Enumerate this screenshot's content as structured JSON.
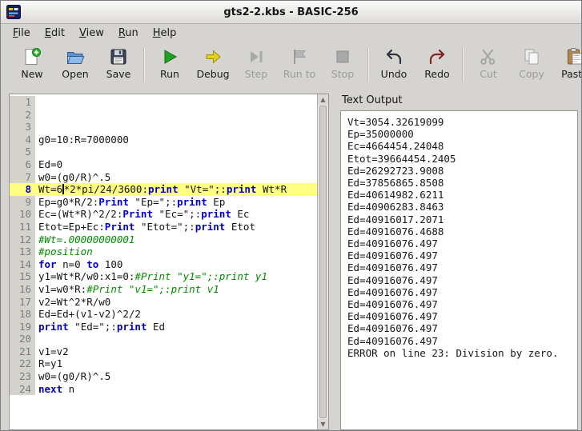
{
  "window": {
    "title": "gts2-2.kbs - BASIC-256"
  },
  "menu": {
    "items": [
      {
        "label": "File"
      },
      {
        "label": "Edit"
      },
      {
        "label": "View"
      },
      {
        "label": "Run"
      },
      {
        "label": "Help"
      }
    ]
  },
  "toolbar": {
    "buttons": [
      {
        "label": "New",
        "enabled": true
      },
      {
        "label": "Open",
        "enabled": true
      },
      {
        "label": "Save",
        "enabled": true
      },
      {
        "label": "Run",
        "enabled": true
      },
      {
        "label": "Debug",
        "enabled": true
      },
      {
        "label": "Step",
        "enabled": false
      },
      {
        "label": "Run to",
        "enabled": false
      },
      {
        "label": "Stop",
        "enabled": false
      },
      {
        "label": "Undo",
        "enabled": true
      },
      {
        "label": "Redo",
        "enabled": true
      },
      {
        "label": "Cut",
        "enabled": false
      },
      {
        "label": "Copy",
        "enabled": false
      },
      {
        "label": "Paste",
        "enabled": true
      }
    ]
  },
  "editor": {
    "current_line": 8,
    "lines": [
      {
        "n": 1,
        "seg": []
      },
      {
        "n": 2,
        "seg": []
      },
      {
        "n": 3,
        "seg": []
      },
      {
        "n": 4,
        "seg": [
          [
            "p",
            "g0=10:R=7000000"
          ]
        ]
      },
      {
        "n": 5,
        "seg": []
      },
      {
        "n": 6,
        "seg": [
          [
            "p",
            "Ed=0"
          ]
        ]
      },
      {
        "n": 7,
        "seg": [
          [
            "p",
            "w0=(g0/R)^.5"
          ]
        ]
      },
      {
        "n": 8,
        "hl": true,
        "seg": [
          [
            "p",
            "Wt=6"
          ],
          [
            "caret",
            ""
          ],
          [
            "p",
            "*2*pi/24/3600:"
          ],
          [
            "k",
            "print"
          ],
          [
            "p",
            " \"Vt=\";:"
          ],
          [
            "k",
            "print"
          ],
          [
            "p",
            " Wt*R"
          ]
        ]
      },
      {
        "n": 9,
        "seg": [
          [
            "p",
            "Ep=g0*R/2:"
          ],
          [
            "k",
            "Print"
          ],
          [
            "p",
            " \"Ep=\";:"
          ],
          [
            "k",
            "print"
          ],
          [
            "p",
            " Ep"
          ]
        ]
      },
      {
        "n": 10,
        "seg": [
          [
            "p",
            "Ec=(Wt*R)^2/2:"
          ],
          [
            "k",
            "Print"
          ],
          [
            "p",
            " \"Ec=\";:"
          ],
          [
            "k",
            "print"
          ],
          [
            "p",
            " Ec"
          ]
        ]
      },
      {
        "n": 11,
        "seg": [
          [
            "p",
            "Etot=Ep+Ec:"
          ],
          [
            "k",
            "Print"
          ],
          [
            "p",
            " \"Etot=\";:"
          ],
          [
            "k",
            "print"
          ],
          [
            "p",
            " Etot"
          ]
        ]
      },
      {
        "n": 12,
        "seg": [
          [
            "c",
            "#Wt=.00000000001"
          ]
        ]
      },
      {
        "n": 13,
        "seg": [
          [
            "c",
            "#position"
          ]
        ]
      },
      {
        "n": 14,
        "seg": [
          [
            "k",
            "for"
          ],
          [
            "p",
            " n=0 "
          ],
          [
            "k",
            "to"
          ],
          [
            "p",
            " 100"
          ]
        ]
      },
      {
        "n": 15,
        "seg": [
          [
            "p",
            "y1=Wt*R/w0:x1=0:"
          ],
          [
            "c",
            "#Print \"y1=\";:print y1"
          ]
        ]
      },
      {
        "n": 16,
        "seg": [
          [
            "p",
            "v1=w0*R:"
          ],
          [
            "c",
            "#Print \"v1=\";:print v1"
          ]
        ]
      },
      {
        "n": 17,
        "seg": [
          [
            "p",
            "v2=Wt^2*R/w0"
          ]
        ]
      },
      {
        "n": 18,
        "seg": [
          [
            "p",
            "Ed=Ed+(v1-v2)^2/2"
          ]
        ]
      },
      {
        "n": 19,
        "seg": [
          [
            "k",
            "print"
          ],
          [
            "p",
            " \"Ed=\";:"
          ],
          [
            "k",
            "print"
          ],
          [
            "p",
            " Ed"
          ]
        ]
      },
      {
        "n": 20,
        "seg": []
      },
      {
        "n": 21,
        "seg": [
          [
            "p",
            "v1=v2"
          ]
        ]
      },
      {
        "n": 22,
        "seg": [
          [
            "p",
            "R=y1"
          ]
        ]
      },
      {
        "n": 23,
        "seg": [
          [
            "p",
            "w0=(g0/R)^.5"
          ]
        ]
      },
      {
        "n": 24,
        "seg": [
          [
            "k",
            "next"
          ],
          [
            "p",
            " n"
          ]
        ]
      }
    ]
  },
  "output": {
    "label": "Text Output",
    "lines": [
      "Vt=3054.32619099",
      "Ep=35000000",
      "Ec=4664454.24048",
      "Etot=39664454.2405",
      "Ed=26292723.9008",
      "Ed=37856865.8508",
      "Ed=40614982.6211",
      "Ed=40906283.8463",
      "Ed=40916017.2071",
      "Ed=40916076.4688",
      "Ed=40916076.497",
      "Ed=40916076.497",
      "Ed=40916076.497",
      "Ed=40916076.497",
      "Ed=40916076.497",
      "Ed=40916076.497",
      "Ed=40916076.497",
      "Ed=40916076.497",
      "Ed=40916076.497",
      "ERROR on line 23: Division by zero."
    ]
  },
  "colors": {
    "keyword": "#0000c8",
    "comment": "#008b00",
    "highlight_line": "#ffff84",
    "run_accent": "#21a121",
    "debug_accent": "#e2cf1d"
  }
}
